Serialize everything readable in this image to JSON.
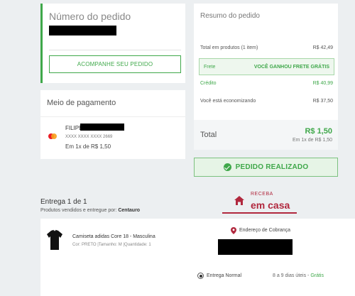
{
  "order": {
    "title": "Número do pedido",
    "track_button": "ACOMPANHE SEU PEDIDO"
  },
  "payment": {
    "title": "Meio de pagamento",
    "holder_name": "FILIPE",
    "card_number": "XXXX XXXX XXXX 2669",
    "installments": "Em 1x de R$ 1,50",
    "card_icon": "mastercard-icon"
  },
  "summary": {
    "title": "Resumo do pedido",
    "products_label": "Total em produtos (1 item)",
    "products_value": "R$ 42,49",
    "freight_label": "Frete",
    "freight_value": "VOCÊ GANHOU FRETE GRÁTIS",
    "credit_label": "Crédito",
    "credit_value": "R$ 40,99",
    "saving_label": "Você está economizando",
    "saving_value": "R$ 37,50",
    "total_label": "Total",
    "total_value": "R$ 1,50",
    "total_installments": "Em 1x de R$ 1,50"
  },
  "status": {
    "banner_text": "PEDIDO REALIZADO",
    "banner_icon": "check-circle-icon"
  },
  "delivery": {
    "title": "Entrega 1 de 1",
    "sold_by_prefix": "Produtos vendidos e entregue por: ",
    "sold_by_store": "Centauro",
    "receba": "RECEBA",
    "em_casa": "em casa",
    "product_name": "Camiseta adidas Core 18 - Masculina",
    "product_attrs": "Cor: PRETO |Tamanho: M |Quantidade: 1",
    "address_title": "Endereço de Cobrança",
    "shipping_method": "Entrega Normal",
    "shipping_days": "8 a 9 dias úteis - ",
    "shipping_price": "Grátis"
  },
  "colors": {
    "accent_green": "#3fa84a",
    "brand_red": "#b1283e",
    "background": "#eceff1"
  }
}
